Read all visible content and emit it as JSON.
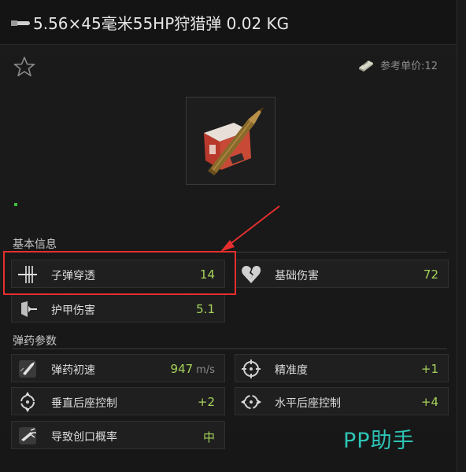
{
  "header": {
    "title": "5.56×45毫米55HP狩猎弹 0.02 KG",
    "price_label": "参考单价:12"
  },
  "sections": {
    "basic": "基本信息",
    "ammo": "弹药参数"
  },
  "stats": {
    "penetration": {
      "label": "子弹穿透",
      "value": "14"
    },
    "base_damage": {
      "label": "基础伤害",
      "value": "72"
    },
    "armor_damage": {
      "label": "护甲伤害",
      "value": "5.1"
    },
    "velocity": {
      "label": "弹药初速",
      "value": "947",
      "unit": "m/s"
    },
    "accuracy": {
      "label": "精准度",
      "value": "+1"
    },
    "vertical_recoil": {
      "label": "垂直后座控制",
      "value": "+2"
    },
    "horizontal_recoil": {
      "label": "水平后座控制",
      "value": "+4"
    },
    "fragmentation": {
      "label": "导致创口概率",
      "value": "中"
    }
  },
  "watermark": "PP助手",
  "colors": {
    "value_green": "#a6d35a",
    "highlight_red": "#e62e2e",
    "watermark_teal": "#2ec4b6"
  }
}
